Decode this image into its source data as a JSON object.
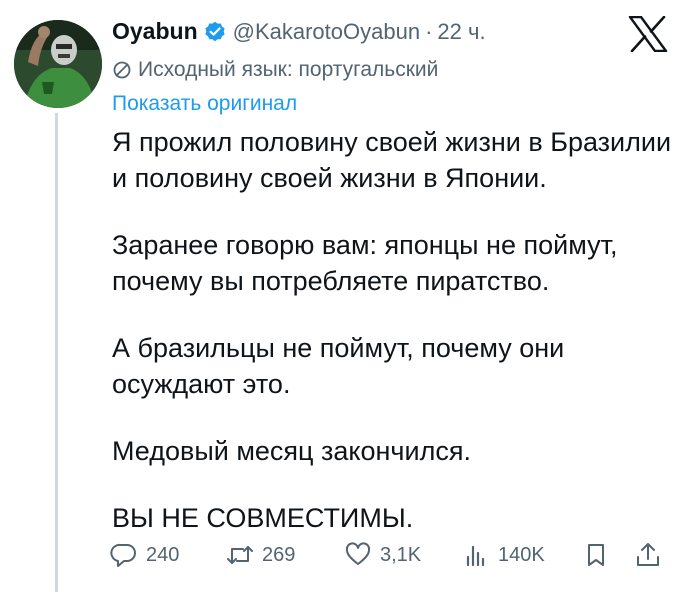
{
  "author": {
    "display_name": "Oyabun",
    "handle": "@KakarotoOyabun",
    "separator": "·",
    "time": "22 ч."
  },
  "translation": {
    "notice": "Исходный язык: португальский",
    "show_original": "Показать оригинал"
  },
  "tweet": {
    "paragraphs": [
      {
        "lines": [
          "Я прожил половину своей жизни в Бразилии",
          "и половину своей жизни в Японии."
        ]
      },
      {
        "lines": [
          "Заранее говорю вам: японцы не поймут,",
          "почему вы потребляете пиратство."
        ]
      },
      {
        "lines": [
          "А бразильцы не поймут, почему они",
          "осуждают это."
        ]
      },
      {
        "lines": [
          "Медовый месяц закончился."
        ]
      },
      {
        "lines": [
          "ВЫ НЕ СОВМЕСТИМЫ."
        ]
      }
    ]
  },
  "actions": {
    "replies": "240",
    "reposts": "269",
    "likes": "3,1K",
    "views": "140K"
  },
  "colors": {
    "text": "#0f1419",
    "secondary": "#536471",
    "link": "#1d9bf0",
    "verified": "#1d9bf0",
    "thread_line": "#cfd9de"
  },
  "icons": {
    "verified": "verified-badge-icon",
    "logo": "x-logo-icon",
    "translate": "translate-icon",
    "reply": "reply-icon",
    "repost": "repost-icon",
    "like": "heart-icon",
    "views": "views-icon",
    "bookmark": "bookmark-icon",
    "share": "share-icon"
  }
}
